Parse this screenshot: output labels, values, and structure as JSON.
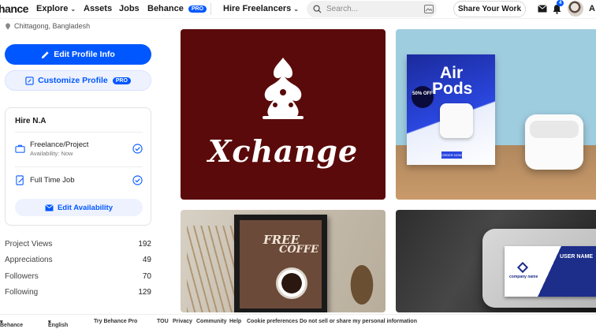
{
  "header": {
    "logo": "hance",
    "nav": {
      "explore": "Explore",
      "assets": "Assets",
      "jobs": "Jobs",
      "behance": "Behance",
      "pro_badge": "PRO",
      "hire": "Hire Freelancers"
    },
    "search_placeholder": "Search...",
    "share_label": "Share Your Work",
    "notification_count": "4",
    "adobe_mark": "A"
  },
  "profile": {
    "location": "Chittagong, Bangladesh",
    "edit_label": "Edit Profile Info",
    "customize_label": "Customize Profile",
    "customize_badge": "PRO"
  },
  "hire_card": {
    "title": "Hire N.A",
    "freelance": {
      "label": "Freelance/Project",
      "availability": "Availability: Now"
    },
    "fulltime": {
      "label": "Full Time Job"
    },
    "edit_availability": "Edit Availability"
  },
  "stats": [
    {
      "label": "Project Views",
      "value": "192"
    },
    {
      "label": "Appreciations",
      "value": "49"
    },
    {
      "label": "Followers",
      "value": "70"
    },
    {
      "label": "Following",
      "value": "129"
    }
  ],
  "projects": {
    "p1": {
      "title": "Xchange"
    },
    "p2": {
      "line1": "Air",
      "line2": "Pods",
      "sale": "50% OFF",
      "cta": "ORDER NOW"
    },
    "p3": {
      "line1": "FREE",
      "line2": "COFFE"
    },
    "p4": {
      "name": "USER NAME",
      "company": "company name"
    }
  },
  "footer": {
    "behance": "Behance",
    "language": "English",
    "try_pro": "Try Behance Pro",
    "tou": "TOU",
    "privacy": "Privacy",
    "community": "Community",
    "help": "Help",
    "cookies": "Cookie preferences",
    "dnsell": "Do not sell or share my personal information"
  },
  "colors": {
    "accent": "#0057ff",
    "brand_dark_red": "#5a0a0a"
  }
}
